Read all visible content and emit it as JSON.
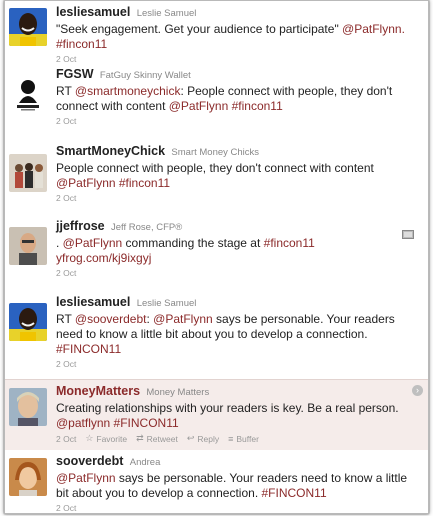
{
  "tweets": [
    {
      "username": "lesliesamuel",
      "fullname": "Leslie Samuel",
      "parts": [
        {
          "t": "\"Seek engagement. Get your audience to participate\"",
          "link": false
        },
        {
          "t": " @PatFlynn.",
          "link": true
        },
        {
          "t": " #fincon11",
          "link": true
        }
      ],
      "time": "2 Oct",
      "avatar": "avatar-leslie"
    },
    {
      "username": "FGSW",
      "fullname": "FatGuy Skinny Wallet",
      "parts": [
        {
          "t": "RT ",
          "link": false
        },
        {
          "t": "@smartmoneychick",
          "link": true
        },
        {
          "t": ": People connect with people, they don't connect with content ",
          "link": false
        },
        {
          "t": "@PatFlynn",
          "link": true
        },
        {
          "t": " #fincon11",
          "link": true
        }
      ],
      "time": "2 Oct",
      "avatar": "avatar-fgsw"
    },
    {
      "username": "SmartMoneyChick",
      "fullname": "Smart Money Chicks",
      "parts": [
        {
          "t": "People connect with people, they don't connect with content ",
          "link": false
        },
        {
          "t": "@PatFlynn",
          "link": true
        },
        {
          "t": " #fincon11",
          "link": true
        }
      ],
      "time": "2 Oct",
      "avatar": "avatar-smartmoney"
    },
    {
      "username": "jjeffrose",
      "fullname": "Jeff Rose, CFP®",
      "parts": [
        {
          "t": ". ",
          "link": false
        },
        {
          "t": "@PatFlynn",
          "link": true
        },
        {
          "t": " commanding the stage at ",
          "link": false
        },
        {
          "t": "#fincon11",
          "link": true
        },
        {
          "t": " yfrog.com/kj9ixgyj",
          "link": true
        }
      ],
      "time": "2 Oct",
      "avatar": "avatar-jeff",
      "has_media": true
    },
    {
      "username": "lesliesamuel",
      "fullname": "Leslie Samuel",
      "parts": [
        {
          "t": "RT ",
          "link": false
        },
        {
          "t": "@sooverdebt",
          "link": true
        },
        {
          "t": ": ",
          "link": false
        },
        {
          "t": "@PatFlynn",
          "link": true
        },
        {
          "t": " says be personable. Your readers need to know a little bit about you to develop a connection. ",
          "link": false
        },
        {
          "t": "#FINCON11",
          "link": true
        }
      ],
      "time": "2 Oct",
      "avatar": "avatar-leslie"
    },
    {
      "username": "MoneyMatters",
      "fullname": "Money Matters",
      "parts": [
        {
          "t": "Creating relationships with your readers is key. Be a real person. ",
          "link": false
        },
        {
          "t": "@patflynn",
          "link": true
        },
        {
          "t": " #FINCON11",
          "link": true
        }
      ],
      "time": "2 Oct",
      "avatar": "avatar-moneymatters",
      "highlighted": true,
      "actions": [
        {
          "label": "Favorite",
          "icon": "star-icon"
        },
        {
          "label": "Retweet",
          "icon": "retweet-icon"
        },
        {
          "label": "Reply",
          "icon": "reply-icon"
        },
        {
          "label": "Buffer",
          "icon": "buffer-icon"
        }
      ]
    },
    {
      "username": "sooverdebt",
      "fullname": "Andrea",
      "parts": [
        {
          "t": "@PatFlynn",
          "link": true
        },
        {
          "t": " says be personable. Your readers need to know a little bit about you to develop a connection. ",
          "link": false
        },
        {
          "t": "#FINCON11",
          "link": true
        }
      ],
      "time": "2 Oct",
      "avatar": "avatar-andrea"
    }
  ],
  "colors": {
    "link": "#8b2a2a",
    "highlight_bg": "#f5ecea",
    "username": "#222222",
    "meta": "#999999"
  }
}
